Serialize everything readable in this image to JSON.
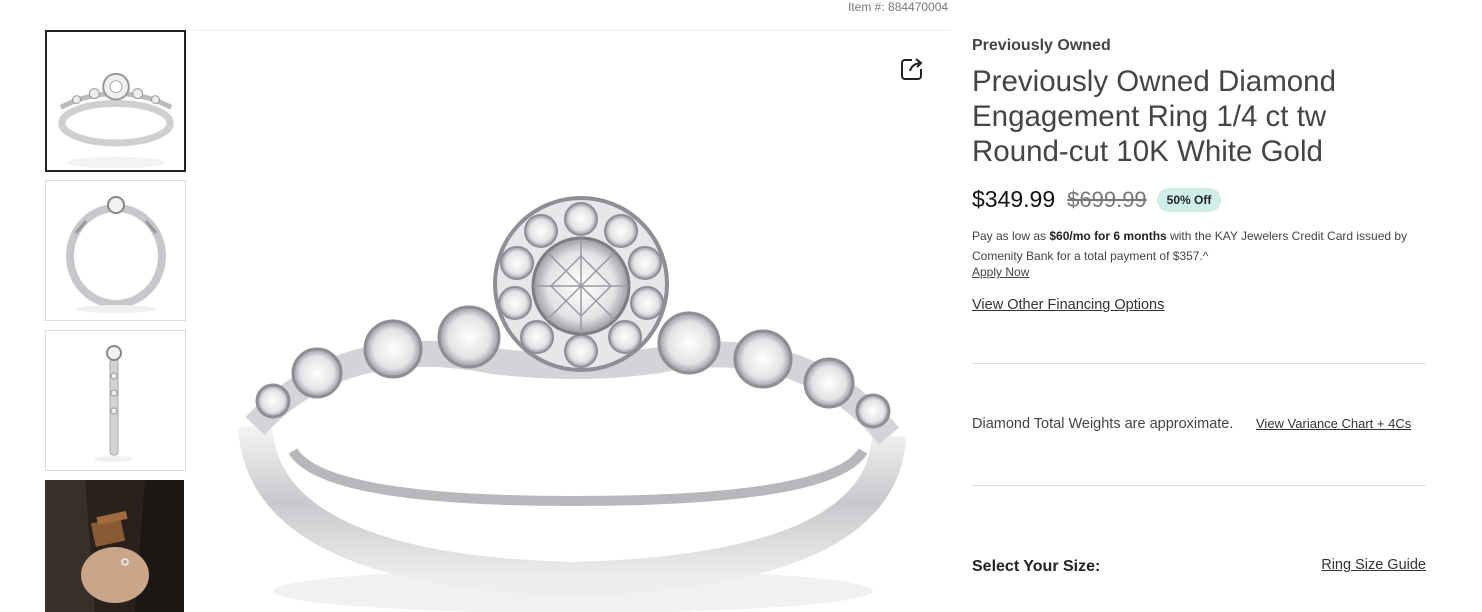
{
  "item_number": "Item #: 884470004",
  "product": {
    "eyebrow": "Previously Owned",
    "title": "Previously Owned Diamond Engagement Ring 1/4 ct tw Round-cut 10K White Gold",
    "price": "$349.99",
    "original_price": "$699.99",
    "discount_badge": "50% Off"
  },
  "financing": {
    "prefix": "Pay as low as ",
    "bold_amount": "$60/mo for 6 months",
    "suffix": " with the KAY Jewelers Credit Card issued by Comenity Bank for a total payment of $357.^",
    "apply_label": "Apply Now",
    "other_options_label": "View Other Financing Options"
  },
  "weights": {
    "note": "Diamond Total Weights are approximate.",
    "variance_link": "View Variance Chart + 4Cs"
  },
  "size": {
    "label": "Select Your Size:",
    "guide_link": "Ring Size Guide"
  },
  "gallery": {
    "thumbnails": [
      "ring-front-view",
      "ring-side-view",
      "ring-profile-view",
      "lifestyle-gift-box"
    ],
    "active_index": 0,
    "icons": {
      "share": "share-icon"
    }
  },
  "colors": {
    "badge_bg": "#cfeee8",
    "metal": "#d9d9dc"
  }
}
